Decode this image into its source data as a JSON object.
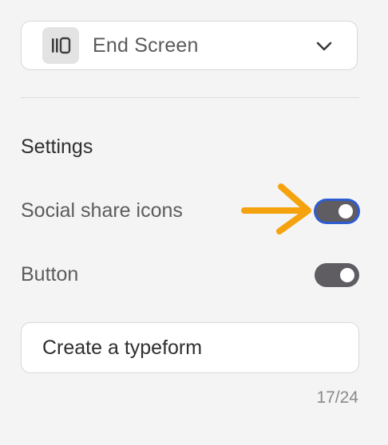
{
  "screen_select": {
    "label": "End Screen",
    "icon": "end-screen-icon",
    "dropdown_icon": "chevron-down-icon"
  },
  "settings": {
    "title": "Settings",
    "items": [
      {
        "label": "Social share icons",
        "enabled": true,
        "focused": true
      },
      {
        "label": "Button",
        "enabled": true,
        "focused": false
      }
    ]
  },
  "button_text": {
    "value": "Create a typeform",
    "counter": "17/24"
  },
  "annotation": {
    "icon": "arrow-right-icon",
    "color": "#f5a20f"
  },
  "colors": {
    "background": "#f4f4f4",
    "toggle_on": "#5f5c62",
    "focus_ring": "#2d5dd1"
  }
}
